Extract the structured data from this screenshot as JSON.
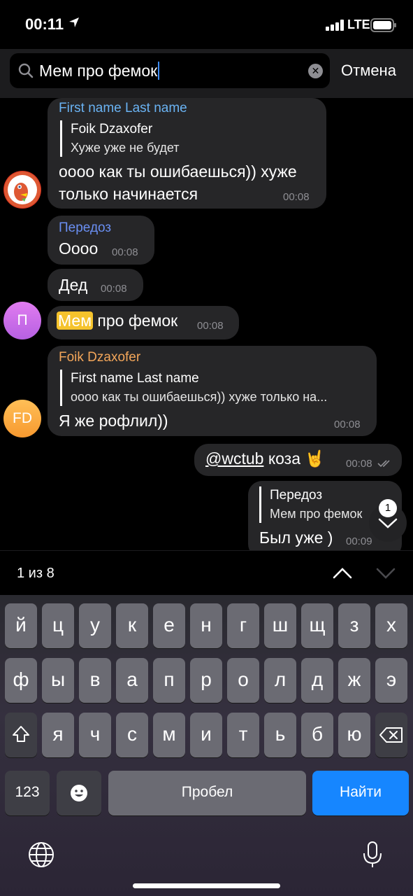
{
  "status_bar": {
    "time": "00:11",
    "network": "LTE"
  },
  "search": {
    "value": "Мем про фемок",
    "cancel_label": "Отмена"
  },
  "messages": [
    {
      "sender": "First name Last name",
      "reply_name": "Foik Dzaxofer",
      "reply_text": "Хуже уже не будет",
      "text_line1": "оооо как ты ошибаешься)) хуже",
      "text_line2": "только начинается",
      "time": "00:08"
    },
    {
      "sender": "Передоз",
      "text": "Оооо",
      "time": "00:08"
    },
    {
      "text": "Дед",
      "time": "00:08"
    },
    {
      "highlight": "Мем",
      "rest": "про фемок",
      "time": "00:08",
      "avatar_letter": "П"
    },
    {
      "sender": "Foik Dzaxofer",
      "reply_name": "First name Last name",
      "reply_text": "оооо как ты ошибаешься)) хуже только на...",
      "text": "Я же рофлил))",
      "time": "00:08",
      "avatar_letters": "FD"
    },
    {
      "mention": "@wctub",
      "text": "коза 🤘",
      "time": "00:08"
    },
    {
      "reply_name": "Передоз",
      "reply_text": "Мем про фемок",
      "text": "Был уже )",
      "time": "00:09"
    }
  ],
  "scroll_badge": "1",
  "result_counter": "1 из 8",
  "keyboard": {
    "row1": [
      "й",
      "ц",
      "у",
      "к",
      "е",
      "н",
      "г",
      "ш",
      "щ",
      "з",
      "х"
    ],
    "row2": [
      "ф",
      "ы",
      "в",
      "а",
      "п",
      "р",
      "о",
      "л",
      "д",
      "ж",
      "э"
    ],
    "row3": [
      "я",
      "ч",
      "с",
      "м",
      "и",
      "т",
      "ь",
      "б",
      "ю"
    ],
    "numbers_label": "123",
    "space_label": "Пробел",
    "go_label": "Найти"
  },
  "colors": {
    "accent": "#1686ff",
    "highlight": "#f5c32c",
    "sender_blue": "#6ab3f3",
    "sender_orange": "#f3a65a",
    "sender_purple": "#7c8ef5"
  }
}
